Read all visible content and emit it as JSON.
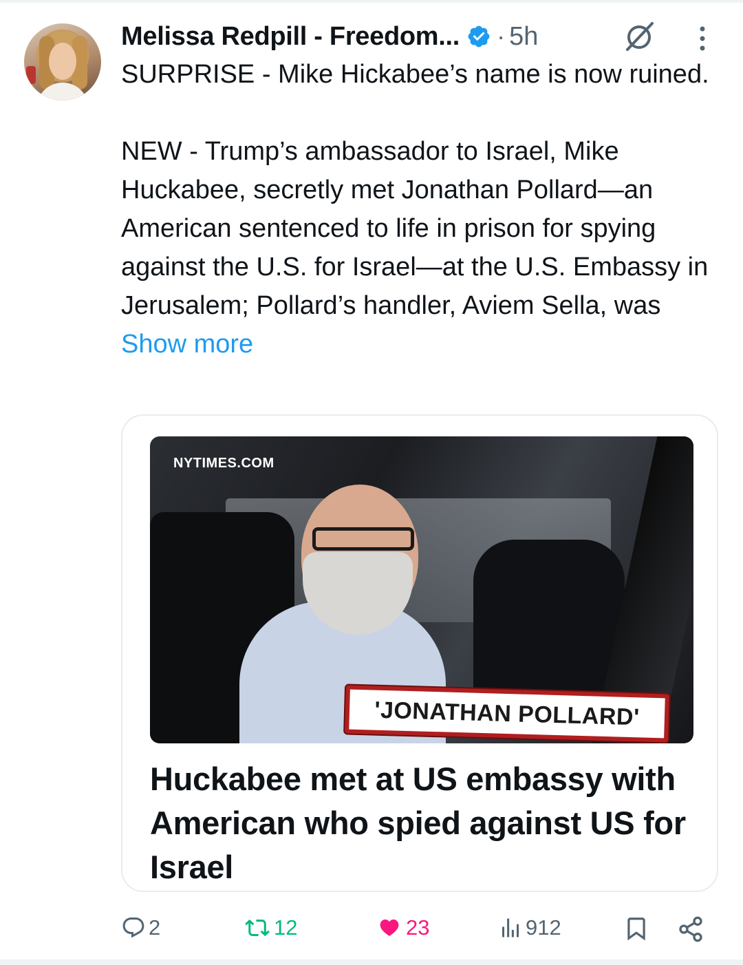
{
  "tweet": {
    "author_name": "Melissa Redpill - Freedom...",
    "time_separator": "·",
    "time": "5h",
    "text_line1": "SURPRISE - Mike Hickabee’s name is now ruined.",
    "text_para2": "NEW - Trump’s ambassador to Israel, Mike Huckabee, secretly met Jonathan Pollard—an American sentenced to life in prison for spying against the U.S. for Israel—at the U.S. Embassy in Jerusalem; Pollard’s handler, Aviem Sella, was",
    "show_more": "Show more"
  },
  "card": {
    "site": "NYTIMES.COM",
    "image_tag": "'JONATHAN POLLARD'",
    "title": "Huckabee met at US embassy with American who spied against US for Israel"
  },
  "actions": {
    "replies": "2",
    "retweets": "12",
    "likes": "23",
    "views": "912"
  },
  "colors": {
    "link": "#1d9bf0",
    "retweet": "#00ba7c",
    "like": "#f91880",
    "secondary": "#536471",
    "verified": "#1d9bf0"
  },
  "icons": [
    "verified-badge-icon",
    "grok-icon",
    "more-options-icon",
    "reply-icon",
    "retweet-icon",
    "like-icon",
    "views-icon",
    "bookmark-icon",
    "share-icon"
  ]
}
